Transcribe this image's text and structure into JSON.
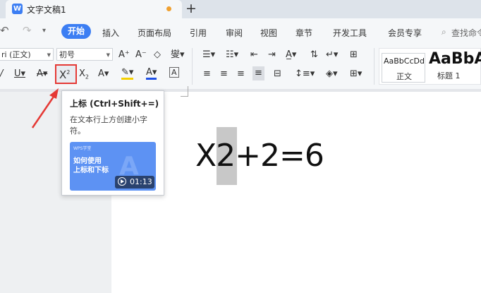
{
  "window": {
    "tab_title": "文字文稿1",
    "new_tab": "+",
    "doc_icon_letter": "W"
  },
  "menu": {
    "items": [
      "开始",
      "插入",
      "页面布局",
      "引用",
      "审阅",
      "视图",
      "章节",
      "开发工具",
      "会员专享"
    ],
    "search_label": "查找命令"
  },
  "ribbon": {
    "font_name": "ri (正文)",
    "font_size": "初号",
    "styles": [
      {
        "sample": "AaBbCcDd",
        "label": "正文"
      },
      {
        "sample": "AaBbA",
        "label": "标题 1"
      }
    ]
  },
  "document": {
    "equation": "X2+2=6"
  },
  "tooltip": {
    "title": "上标 (Ctrl+Shift+=)",
    "description": "在文本行上方创建小字符。",
    "card_brand": "WPS学堂",
    "card_text": "如何使用\n上标和下标",
    "duration": "01:13"
  },
  "colors": {
    "accent": "#3c7ef3",
    "highlight_box": "#e53935",
    "arrow": "#e53935"
  }
}
